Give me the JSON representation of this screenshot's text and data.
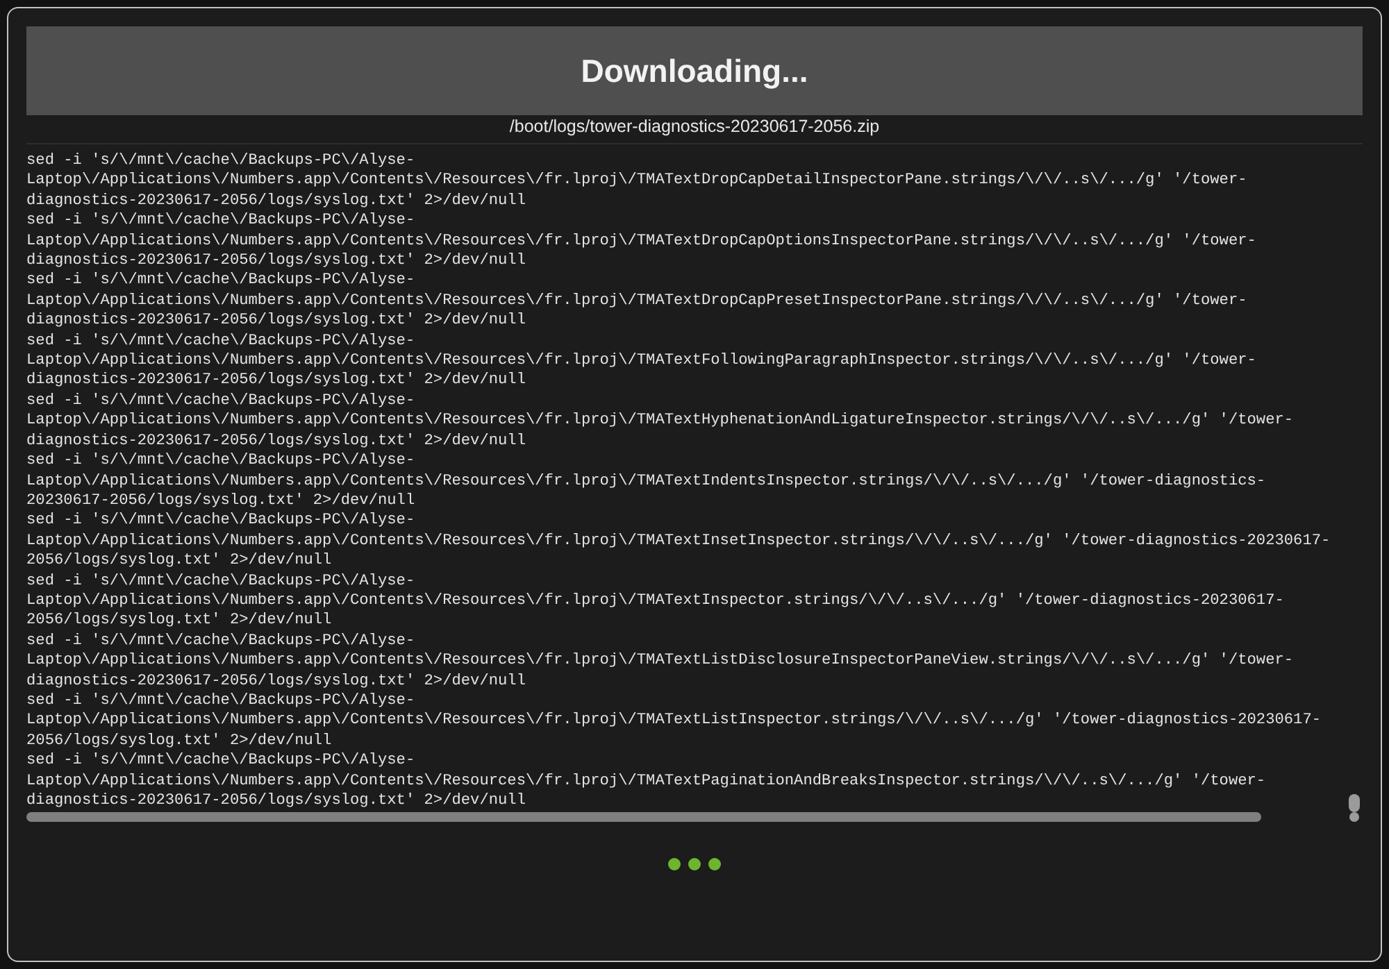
{
  "dialog": {
    "title": "Downloading...",
    "file_path": "/boot/logs/tower-diagnostics-20230617-2056.zip",
    "log": [
      {
        "lines": [
          "sed -i 's/\\/mnt\\/cache\\/Backups-PC\\/Alyse-",
          "Laptop\\/Applications\\/Numbers.app\\/Contents\\/Resources\\/fr.lproj\\/TMATextDropCapDetailInspectorPane.strings/\\/\\/..s\\/.../g' '/tower-",
          "diagnostics-20230617-2056/logs/syslog.txt' 2>/dev/null"
        ]
      },
      {
        "lines": [
          "sed -i 's/\\/mnt\\/cache\\/Backups-PC\\/Alyse-",
          "Laptop\\/Applications\\/Numbers.app\\/Contents\\/Resources\\/fr.lproj\\/TMATextDropCapOptionsInspectorPane.strings/\\/\\/..s\\/.../g' '/tower-",
          "diagnostics-20230617-2056/logs/syslog.txt' 2>/dev/null"
        ]
      },
      {
        "lines": [
          "sed -i 's/\\/mnt\\/cache\\/Backups-PC\\/Alyse-",
          "Laptop\\/Applications\\/Numbers.app\\/Contents\\/Resources\\/fr.lproj\\/TMATextDropCapPresetInspectorPane.strings/\\/\\/..s\\/.../g' '/tower-",
          "diagnostics-20230617-2056/logs/syslog.txt' 2>/dev/null"
        ]
      },
      {
        "lines": [
          "sed -i 's/\\/mnt\\/cache\\/Backups-PC\\/Alyse-",
          "Laptop\\/Applications\\/Numbers.app\\/Contents\\/Resources\\/fr.lproj\\/TMATextFollowingParagraphInspector.strings/\\/\\/..s\\/.../g' '/tower-",
          "diagnostics-20230617-2056/logs/syslog.txt' 2>/dev/null"
        ]
      },
      {
        "lines": [
          "sed -i 's/\\/mnt\\/cache\\/Backups-PC\\/Alyse-",
          "Laptop\\/Applications\\/Numbers.app\\/Contents\\/Resources\\/fr.lproj\\/TMATextHyphenationAndLigatureInspector.strings/\\/\\/..s\\/.../g' '/tower-",
          "diagnostics-20230617-2056/logs/syslog.txt' 2>/dev/null"
        ]
      },
      {
        "lines": [
          "sed -i 's/\\/mnt\\/cache\\/Backups-PC\\/Alyse-",
          "Laptop\\/Applications\\/Numbers.app\\/Contents\\/Resources\\/fr.lproj\\/TMATextIndentsInspector.strings/\\/\\/..s\\/.../g' '/tower-diagnostics-",
          "20230617-2056/logs/syslog.txt' 2>/dev/null"
        ]
      },
      {
        "lines": [
          "sed -i 's/\\/mnt\\/cache\\/Backups-PC\\/Alyse-",
          "Laptop\\/Applications\\/Numbers.app\\/Contents\\/Resources\\/fr.lproj\\/TMATextInsetInspector.strings/\\/\\/..s\\/.../g' '/tower-diagnostics-20230617-",
          "2056/logs/syslog.txt' 2>/dev/null"
        ]
      },
      {
        "lines": [
          "sed -i 's/\\/mnt\\/cache\\/Backups-PC\\/Alyse-",
          "Laptop\\/Applications\\/Numbers.app\\/Contents\\/Resources\\/fr.lproj\\/TMATextInspector.strings/\\/\\/..s\\/.../g' '/tower-diagnostics-20230617-",
          "2056/logs/syslog.txt' 2>/dev/null"
        ]
      },
      {
        "lines": [
          "sed -i 's/\\/mnt\\/cache\\/Backups-PC\\/Alyse-",
          "Laptop\\/Applications\\/Numbers.app\\/Contents\\/Resources\\/fr.lproj\\/TMATextListDisclosureInspectorPaneView.strings/\\/\\/..s\\/.../g' '/tower-",
          "diagnostics-20230617-2056/logs/syslog.txt' 2>/dev/null"
        ]
      },
      {
        "lines": [
          "sed -i 's/\\/mnt\\/cache\\/Backups-PC\\/Alyse-",
          "Laptop\\/Applications\\/Numbers.app\\/Contents\\/Resources\\/fr.lproj\\/TMATextListInspector.strings/\\/\\/..s\\/.../g' '/tower-diagnostics-20230617-",
          "2056/logs/syslog.txt' 2>/dev/null"
        ]
      },
      {
        "lines": [
          "sed -i 's/\\/mnt\\/cache\\/Backups-PC\\/Alyse-",
          "Laptop\\/Applications\\/Numbers.app\\/Contents\\/Resources\\/fr.lproj\\/TMATextPaginationAndBreaksInspector.strings/\\/\\/..s\\/.../g' '/tower-",
          "diagnostics-20230617-2056/logs/syslog.txt' 2>/dev/null"
        ]
      }
    ]
  }
}
